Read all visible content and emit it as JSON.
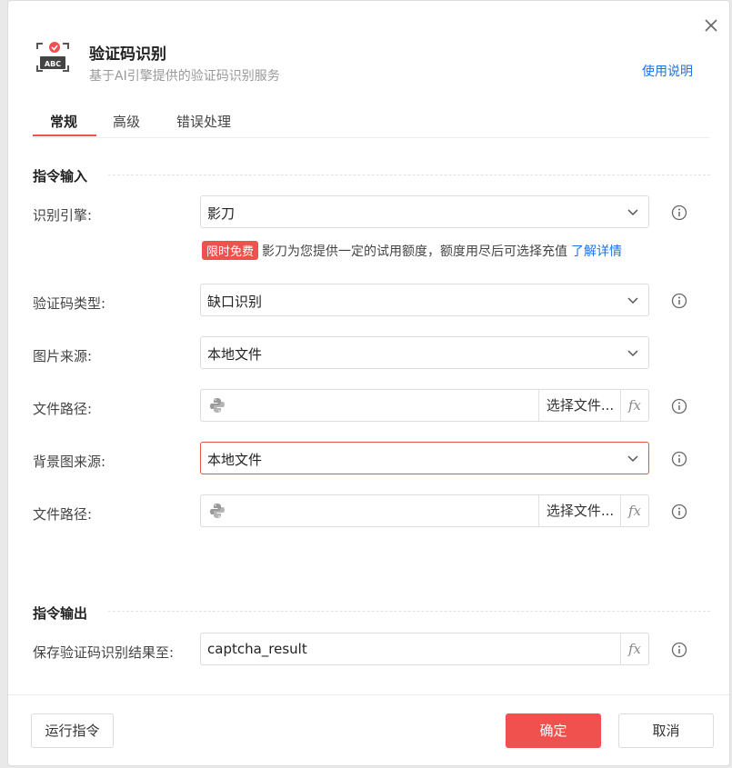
{
  "header": {
    "title": "验证码识别",
    "subtitle": "基于AI引擎提供的验证码识别服务",
    "help_link": "使用说明",
    "icon_text": "ABC"
  },
  "tabs": [
    {
      "label": "常规",
      "active": true
    },
    {
      "label": "高级",
      "active": false
    },
    {
      "label": "错误处理",
      "active": false
    }
  ],
  "input_section": {
    "title": "指令输入",
    "engine": {
      "label": "识别引擎:",
      "value": "影刀"
    },
    "promo": {
      "badge": "限时免费",
      "text": "影刀为您提供一定的试用额度，额度用尽后可选择充值",
      "link": "了解详情"
    },
    "captcha_type": {
      "label": "验证码类型:",
      "value": "缺口识别"
    },
    "image_source": {
      "label": "图片来源:",
      "value": "本地文件"
    },
    "file_path_1": {
      "label": "文件路径:",
      "value": "",
      "choose_label": "选择文件...",
      "fx": "fx"
    },
    "bg_source": {
      "label": "背景图来源:",
      "value": "本地文件"
    },
    "file_path_2": {
      "label": "文件路径:",
      "value": "",
      "choose_label": "选择文件...",
      "fx": "fx"
    }
  },
  "output_section": {
    "title": "指令输出",
    "save_to": {
      "label": "保存验证码识别结果至:",
      "value": "captcha_result",
      "fx": "fx"
    }
  },
  "footer": {
    "run_label": "运行指令",
    "confirm_label": "确定",
    "cancel_label": "取消"
  },
  "colors": {
    "accent": "#f0514e",
    "link": "#1a73e8",
    "error_border": "#e8504b"
  }
}
